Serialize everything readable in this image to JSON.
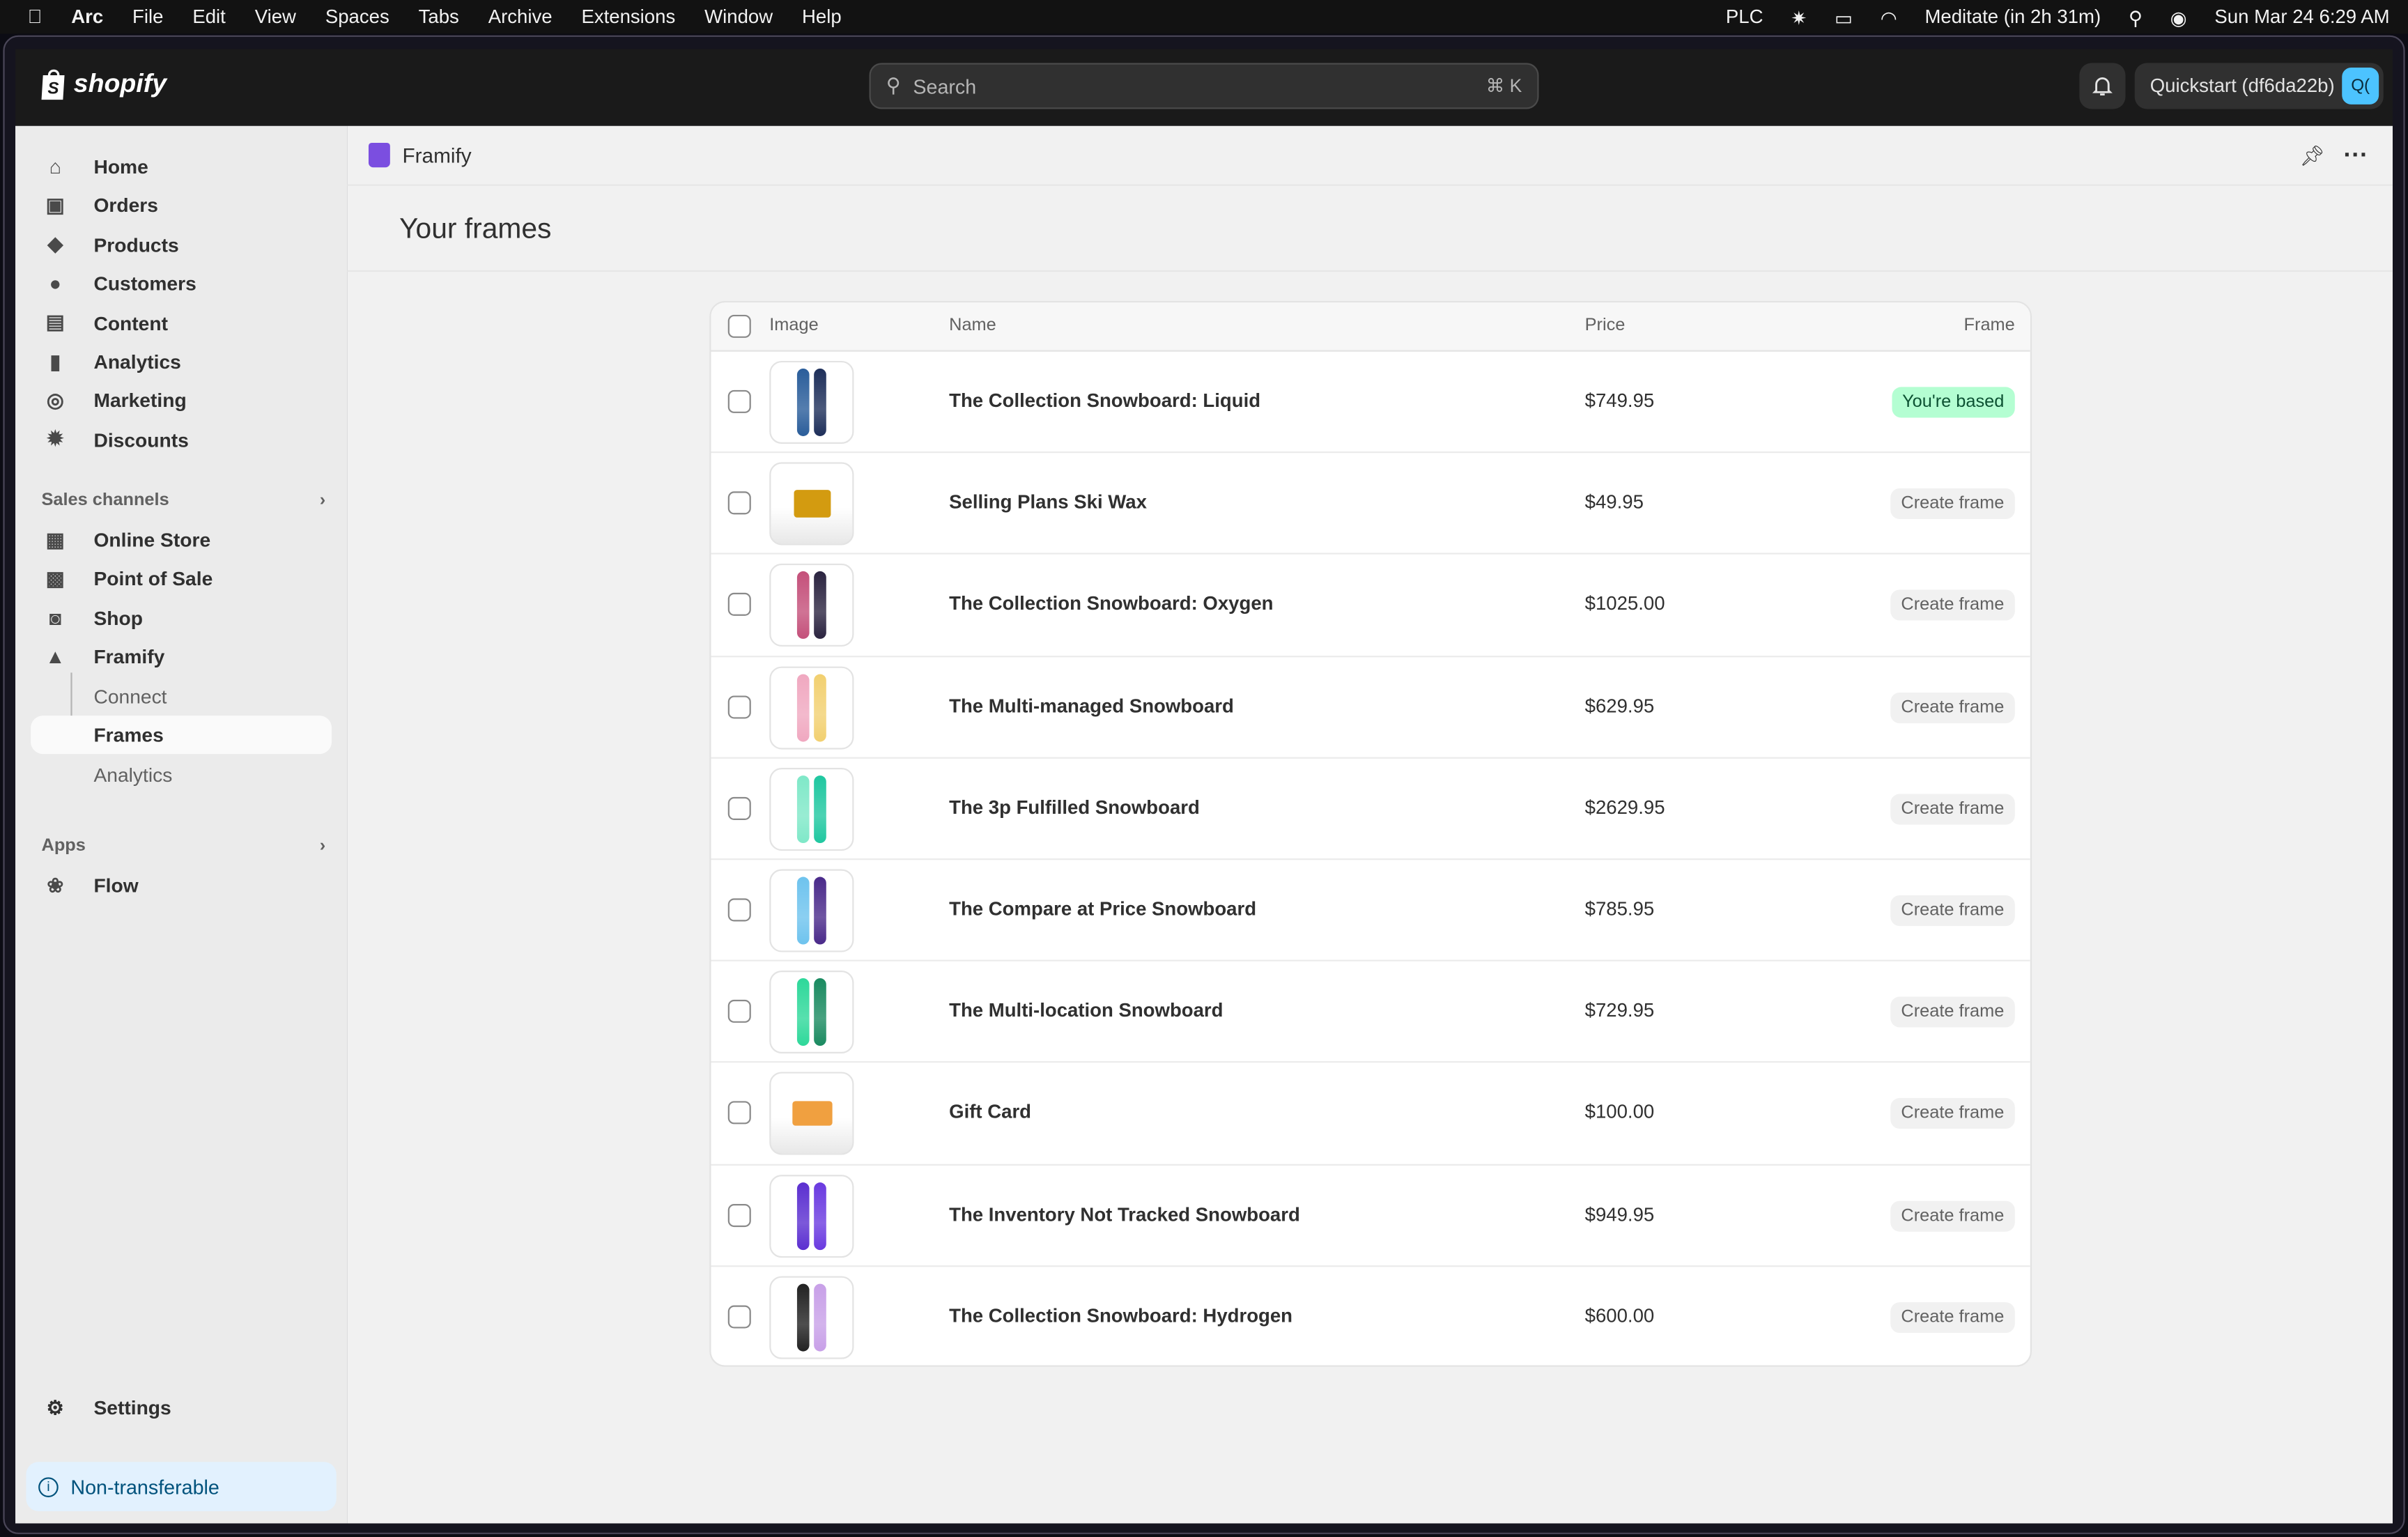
{
  "menubar": {
    "app": "Arc",
    "items": [
      "File",
      "Edit",
      "View",
      "Spaces",
      "Tabs",
      "Archive",
      "Extensions",
      "Window",
      "Help"
    ],
    "plc": "PLC",
    "calendar": "Meditate (in 2h 31m)",
    "datetime": "Sun Mar 24  6:29 AM"
  },
  "topbar": {
    "logo": "shopify",
    "search_placeholder": "Search",
    "search_shortcut": "⌘ K",
    "store": "Quickstart (df6da22b)",
    "avatar": "Q("
  },
  "sidebar": {
    "main": [
      {
        "label": "Home",
        "icon": "home-icon"
      },
      {
        "label": "Orders",
        "icon": "orders-icon"
      },
      {
        "label": "Products",
        "icon": "tag-icon"
      },
      {
        "label": "Customers",
        "icon": "person-icon"
      },
      {
        "label": "Content",
        "icon": "content-icon"
      },
      {
        "label": "Analytics",
        "icon": "bar-chart-icon"
      },
      {
        "label": "Marketing",
        "icon": "target-icon"
      },
      {
        "label": "Discounts",
        "icon": "discount-icon"
      }
    ],
    "sales_channels_label": "Sales channels",
    "channels": [
      {
        "label": "Online Store",
        "icon": "store-icon"
      },
      {
        "label": "Point of Sale",
        "icon": "pos-icon"
      },
      {
        "label": "Shop",
        "icon": "shop-icon"
      },
      {
        "label": "Framify",
        "icon": "framify-icon"
      }
    ],
    "framify_sub": [
      {
        "label": "Connect",
        "active": false
      },
      {
        "label": "Frames",
        "active": true
      },
      {
        "label": "Analytics",
        "active": false
      }
    ],
    "apps_label": "Apps",
    "apps": [
      {
        "label": "Flow",
        "icon": "flow-icon"
      }
    ],
    "settings": "Settings",
    "notice": "Non-transferable"
  },
  "app": {
    "name": "Framify",
    "page_title": "Your frames"
  },
  "table": {
    "headers": {
      "image": "Image",
      "name": "Name",
      "price": "Price",
      "frame": "Frame"
    },
    "rows": [
      {
        "name": "The Collection Snowboard: Liquid",
        "price": "$749.95",
        "frame": "You're based",
        "status": "success",
        "colors": [
          "#2a5d9a",
          "#1e2f5a"
        ]
      },
      {
        "name": "Selling Plans Ski Wax",
        "price": "$49.95",
        "frame": "Create frame",
        "status": "default",
        "colors": [
          "#d39b10"
        ]
      },
      {
        "name": "The Collection Snowboard: Oxygen",
        "price": "$1025.00",
        "frame": "Create frame",
        "status": "default",
        "colors": [
          "#c4507a",
          "#2b2440"
        ]
      },
      {
        "name": "The Multi-managed Snowboard",
        "price": "$629.95",
        "frame": "Create frame",
        "status": "default",
        "colors": [
          "#f0a8c0",
          "#f2d070"
        ]
      },
      {
        "name": "The 3p Fulfilled Snowboard",
        "price": "$2629.95",
        "frame": "Create frame",
        "status": "default",
        "colors": [
          "#7fe8c8",
          "#1fc7a0"
        ]
      },
      {
        "name": "The Compare at Price Snowboard",
        "price": "$785.95",
        "frame": "Create frame",
        "status": "default",
        "colors": [
          "#6ec3ee",
          "#4a2a8a"
        ]
      },
      {
        "name": "The Multi-location Snowboard",
        "price": "$729.95",
        "frame": "Create frame",
        "status": "default",
        "colors": [
          "#2ed89a",
          "#1a8a60"
        ]
      },
      {
        "name": "Gift Card",
        "price": "$100.00",
        "frame": "Create frame",
        "status": "default",
        "colors": [
          "#f0a040"
        ]
      },
      {
        "name": "The Inventory Not Tracked Snowboard",
        "price": "$949.95",
        "frame": "Create frame",
        "status": "default",
        "colors": [
          "#5b2fd0",
          "#6a3ae0"
        ]
      },
      {
        "name": "The Collection Snowboard: Hydrogen",
        "price": "$600.00",
        "frame": "Create frame",
        "status": "default",
        "colors": [
          "#222222",
          "#c8a0e8"
        ]
      }
    ]
  }
}
